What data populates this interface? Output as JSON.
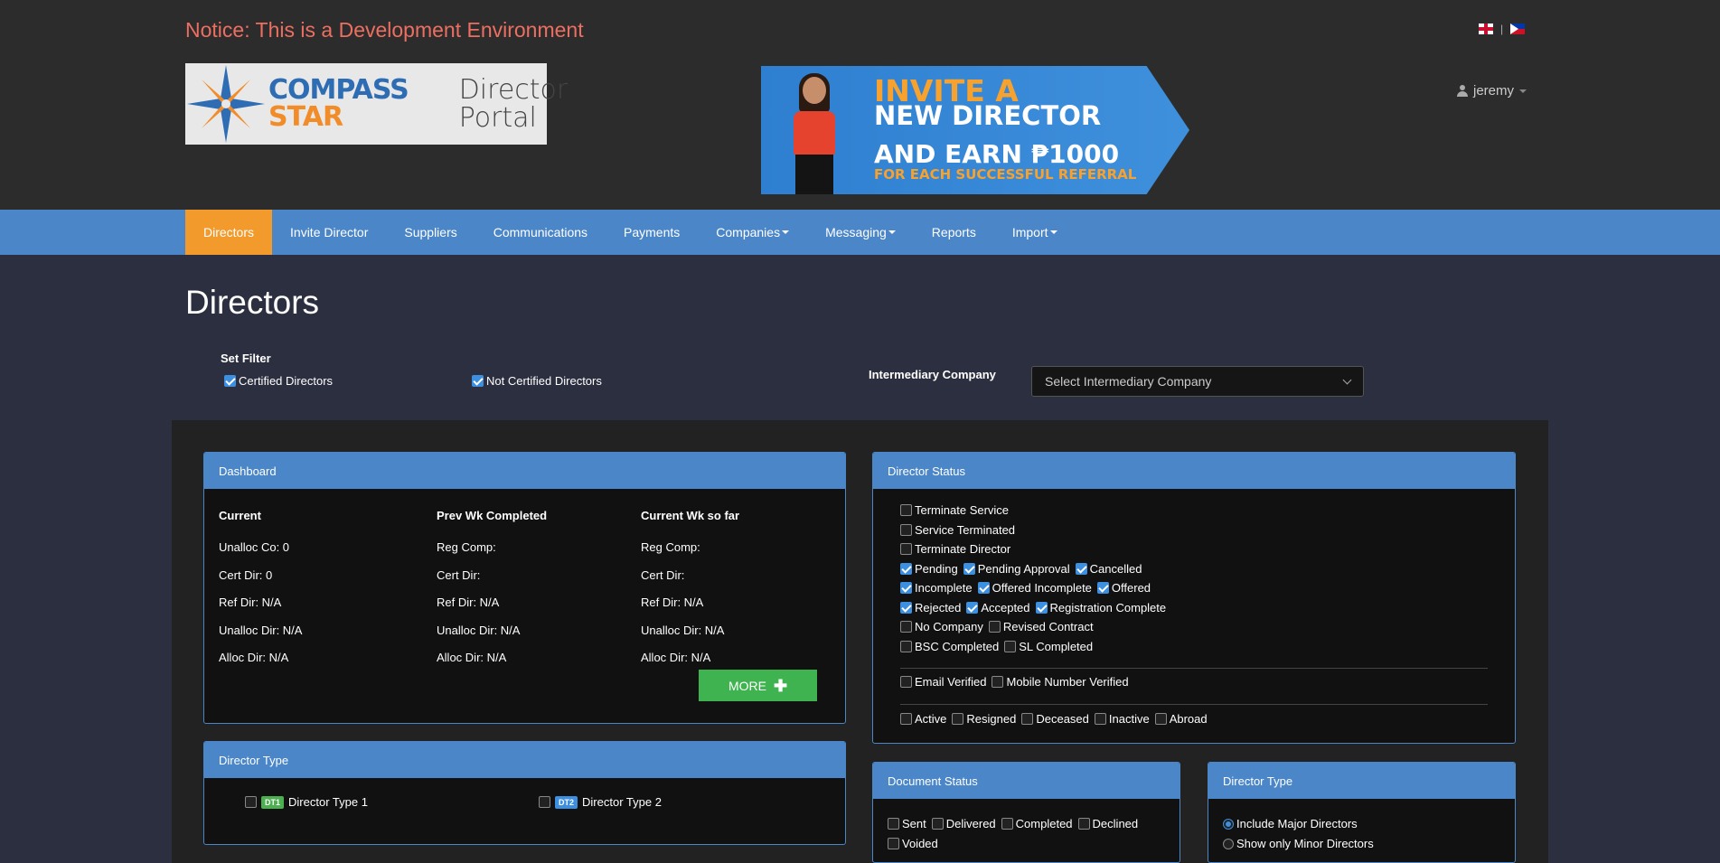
{
  "notice": "Notice: This is a Development Environment",
  "logo": {
    "line1": "COMPASS",
    "line2": "STAR",
    "portal1": "Director",
    "portal2": "Portal"
  },
  "banner": {
    "l1": "INVITE A",
    "l2": "NEW DIRECTOR",
    "l3": "AND EARN ₱1000",
    "l4": "FOR EACH SUCCESSFUL REFERRAL"
  },
  "user": {
    "name": "jeremy"
  },
  "nav": {
    "items": [
      {
        "label": "Directors"
      },
      {
        "label": "Invite Director"
      },
      {
        "label": "Suppliers"
      },
      {
        "label": "Communications"
      },
      {
        "label": "Payments"
      },
      {
        "label": "Companies"
      },
      {
        "label": "Messaging"
      },
      {
        "label": "Reports"
      },
      {
        "label": "Import"
      }
    ]
  },
  "page_title": "Directors",
  "filter": {
    "title": "Set Filter",
    "certified": "Certified Directors",
    "not_certified": "Not Certified Directors",
    "intermediary_label": "Intermediary Company",
    "intermediary_placeholder": "Select Intermediary Company"
  },
  "dashboard": {
    "title": "Dashboard",
    "columns": [
      {
        "header": "Current",
        "rows": [
          "Unalloc Co: 0",
          "Cert Dir: 0",
          "Ref Dir: N/A",
          "Unalloc Dir: N/A",
          "Alloc Dir: N/A"
        ]
      },
      {
        "header": "Prev Wk Completed",
        "rows": [
          "Reg Comp:",
          "Cert Dir:",
          "Ref Dir: N/A",
          "Unalloc Dir: N/A",
          "Alloc Dir: N/A"
        ]
      },
      {
        "header": "Current Wk so far",
        "rows": [
          "Reg Comp:",
          "Cert Dir:",
          "Ref Dir: N/A",
          "Unalloc Dir: N/A",
          "Alloc Dir: N/A"
        ]
      }
    ],
    "more": "MORE"
  },
  "director_type_left": {
    "title": "Director Type",
    "items": [
      {
        "badge": "DT1",
        "label": "Director Type 1"
      },
      {
        "badge": "DT2",
        "label": "Director Type 2"
      }
    ]
  },
  "director_status": {
    "title": "Director Status",
    "rows": [
      [
        {
          "label": "Terminate Service",
          "checked": false
        }
      ],
      [
        {
          "label": "Service Terminated",
          "checked": false
        }
      ],
      [
        {
          "label": "Terminate Director",
          "checked": false
        }
      ],
      [
        {
          "label": "Pending",
          "checked": true
        },
        {
          "label": "Pending Approval",
          "checked": true
        },
        {
          "label": "Cancelled",
          "checked": true
        }
      ],
      [
        {
          "label": "Incomplete",
          "checked": true
        },
        {
          "label": "Offered Incomplete",
          "checked": true
        },
        {
          "label": "Offered",
          "checked": true
        }
      ],
      [
        {
          "label": "Rejected",
          "checked": true
        },
        {
          "label": "Accepted",
          "checked": true
        },
        {
          "label": "Registration Complete",
          "checked": true
        }
      ],
      [
        {
          "label": "No Company",
          "checked": false
        },
        {
          "label": "Revised Contract",
          "checked": false
        }
      ],
      [
        {
          "label": "BSC Completed",
          "checked": false
        },
        {
          "label": "SL Completed",
          "checked": false
        }
      ]
    ],
    "verify_row": [
      {
        "label": "Email Verified",
        "checked": false
      },
      {
        "label": "Mobile Number Verified",
        "checked": false
      }
    ],
    "activity_row": [
      {
        "label": "Active",
        "checked": false
      },
      {
        "label": "Resigned",
        "checked": false
      },
      {
        "label": "Deceased",
        "checked": false
      },
      {
        "label": "Inactive",
        "checked": false
      },
      {
        "label": "Abroad",
        "checked": false
      }
    ]
  },
  "document_status": {
    "title": "Document Status",
    "row1": [
      "Sent",
      "Delivered",
      "Completed",
      "Declined"
    ],
    "row2": [
      "Voided"
    ]
  },
  "director_type_right": {
    "title": "Director Type",
    "options": [
      "Include Major Directors",
      "Show only Minor Directors"
    ]
  }
}
